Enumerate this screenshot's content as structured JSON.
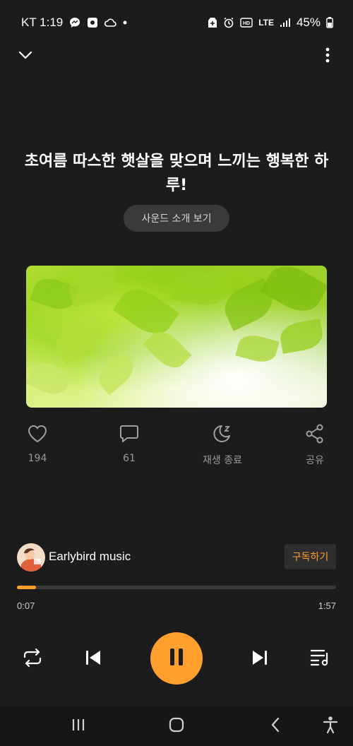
{
  "status_bar": {
    "carrier_time": "KT 1:19",
    "network": "LTE",
    "battery": "45%"
  },
  "title": "초여름 따스한 햇살을 맞으며 느끼는 행복한 하루!",
  "intro_button": "사운드 소개 보기",
  "actions": {
    "like_count": "194",
    "comment_count": "61",
    "sleep_timer_label": "재생 종료",
    "share_label": "공유"
  },
  "channel": {
    "name": "Earlybird music",
    "subscribe_label": "구독하기"
  },
  "player": {
    "current_time": "0:07",
    "total_time": "1:57",
    "progress": 0.06
  },
  "colors": {
    "accent": "#ff9f2e",
    "background": "#1c1c1c"
  },
  "icons": [
    "chevron-down-icon",
    "more-vertical-icon",
    "heart-icon",
    "comment-icon",
    "moon-sleep-icon",
    "share-icon",
    "repeat-icon",
    "previous-icon",
    "pause-icon",
    "next-icon",
    "playlist-icon",
    "recents-icon",
    "home-icon",
    "back-icon",
    "accessibility-icon"
  ]
}
